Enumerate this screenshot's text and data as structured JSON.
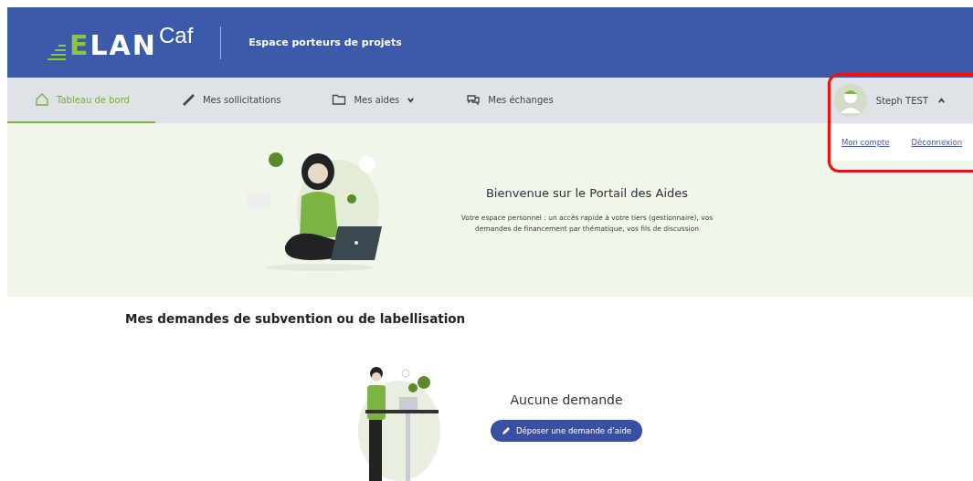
{
  "header": {
    "logo": {
      "lead": "E",
      "main": "LAN",
      "suffix": "Caf"
    },
    "title": "Espace porteurs de projets"
  },
  "nav": {
    "items": [
      {
        "label": "Tableau de bord",
        "kind": "home",
        "selected": true,
        "dropdown": false
      },
      {
        "label": "Mes sollicitations",
        "kind": "pen",
        "selected": false,
        "dropdown": false
      },
      {
        "label": "Mes aides",
        "kind": "folder",
        "selected": false,
        "dropdown": true
      },
      {
        "label": "Mes échanges",
        "kind": "chat",
        "selected": false,
        "dropdown": false
      }
    ]
  },
  "user": {
    "name": "Steph TEST",
    "expanded": true,
    "menu": [
      "Mon compte",
      "Déconnexion"
    ]
  },
  "hero": {
    "title": "Bienvenue sur le Portail des Aides",
    "text": "Votre espace personnel : un accès rapide à votre tiers (gestionnaire), vos demandes de financement par thématique, vos fils de discussion"
  },
  "requests": {
    "heading": "Mes demandes de subvention ou de labellisation",
    "empty_text": "Aucune demande",
    "button": "Déposer une demande d’aide"
  }
}
